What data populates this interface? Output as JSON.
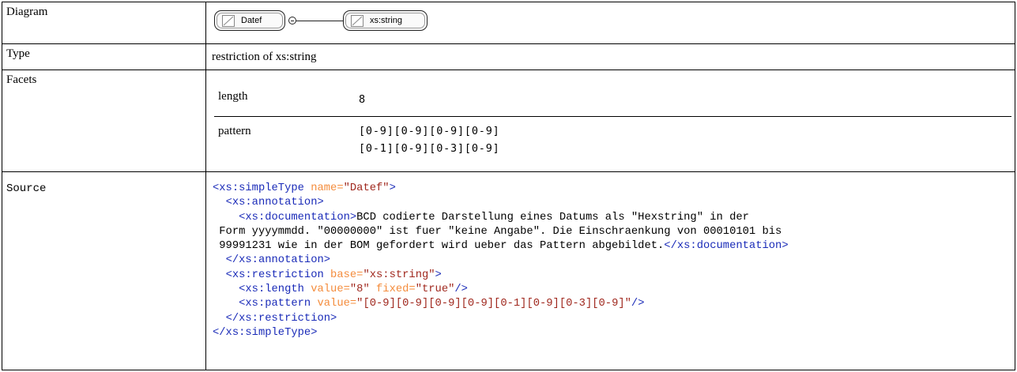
{
  "rows": {
    "diagram": {
      "label": "Diagram"
    },
    "type": {
      "label": "Type",
      "value": "restriction of xs:string"
    },
    "facets": {
      "label": "Facets"
    },
    "source": {
      "label": "Source"
    }
  },
  "diagram": {
    "node_main": {
      "name": "Datef",
      "icon": "simple-type-icon"
    },
    "node_base": {
      "name": "xs:string",
      "icon": "simple-type-icon"
    },
    "connector": "collapse-icon"
  },
  "facets": [
    {
      "name": "length",
      "value_lines": [
        "8"
      ]
    },
    {
      "name": "pattern",
      "value_lines": [
        "[0-9][0-9][0-9][0-9]",
        "[0-1][0-9][0-3][0-9]"
      ]
    }
  ],
  "source": {
    "l1_open": "<xs:simpleType",
    "l1_attr": " name=",
    "l1_val": "\"Datef\"",
    "l1_close": ">",
    "l2": "<xs:annotation>",
    "l3_open": "<xs:documentation>",
    "l3_text": "BCD codierte Darstellung eines Datums als \"Hexstring\" in der",
    "l4_text": "Form yyyymmdd. \"00000000\" ist fuer \"keine Angabe\". Die Einschraenkung von 00010101 bis",
    "l5_text": "99991231 wie in der BOM gefordert wird ueber das Pattern abgebildet.",
    "l5_close": "</xs:documentation>",
    "l6": "</xs:annotation>",
    "l7_open": "<xs:restriction",
    "l7_attr": " base=",
    "l7_val": "\"xs:string\"",
    "l7_close": ">",
    "l8_open": "<xs:length",
    "l8_attr1": " value=",
    "l8_val1": "\"8\"",
    "l8_attr2": " fixed=",
    "l8_val2": "\"true\"",
    "l8_close": "/>",
    "l9_open": "<xs:pattern",
    "l9_attr": " value=",
    "l9_val": "\"[0-9][0-9][0-9][0-9][0-1][0-9][0-3][0-9]\"",
    "l9_close": "/>",
    "l10": "</xs:restriction>",
    "l11": "</xs:simpleType>"
  },
  "colors": {
    "tag": "#1a2bb8",
    "attribute": "#f48c3c",
    "attribute_value": "#a0281e",
    "border": "#000000"
  }
}
